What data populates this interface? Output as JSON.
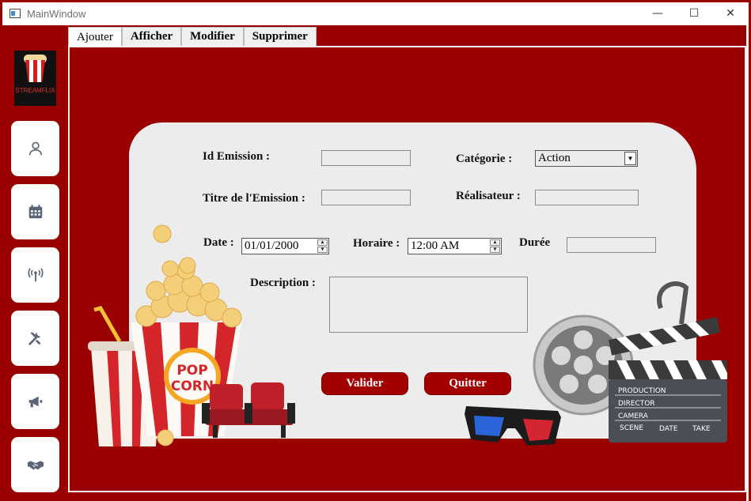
{
  "window": {
    "title": "MainWindow",
    "min": "—",
    "max": "☐",
    "close": "✕"
  },
  "logo": {
    "text": "STREAMFLIX"
  },
  "colors": {
    "background": "#9b0000",
    "card": "#ececec",
    "button": "#a20000"
  },
  "sidebar": {
    "buttons": [
      {
        "icon": "user-icon"
      },
      {
        "icon": "calendar-icon"
      },
      {
        "icon": "broadcast-icon"
      },
      {
        "icon": "tools-icon"
      },
      {
        "icon": "megaphone-icon"
      },
      {
        "icon": "handshake-icon"
      }
    ]
  },
  "tabs": [
    {
      "label": "Ajouter",
      "active": true
    },
    {
      "label": "Afficher"
    },
    {
      "label": "Modifier"
    },
    {
      "label": "Supprimer"
    }
  ],
  "form": {
    "id_label": "Id Emission :",
    "id_value": "",
    "categorie_label": "Catégorie :",
    "categorie_value": "Action",
    "titre_label": "Titre de l'Emission :",
    "titre_value": "",
    "realisateur_label": "Réalisateur :",
    "realisateur_value": "",
    "date_label": "Date :",
    "date_value": "01/01/2000",
    "horaire_label": "Horaire :",
    "horaire_value": "12:00 AM",
    "duree_label": "Durée",
    "duree_value": "",
    "description_label": "Description :",
    "description_value": ""
  },
  "buttons": {
    "valider": "Valider",
    "quitter": "Quitter"
  },
  "decor": {
    "popcorn_text_1": "POP",
    "popcorn_text_2": "CORN",
    "clapper_lines": [
      "PRODUCTION",
      "DIRECTOR",
      "CAMERA"
    ],
    "clapper_bottom": [
      "SCENE",
      "DATE",
      "TAKE"
    ]
  }
}
